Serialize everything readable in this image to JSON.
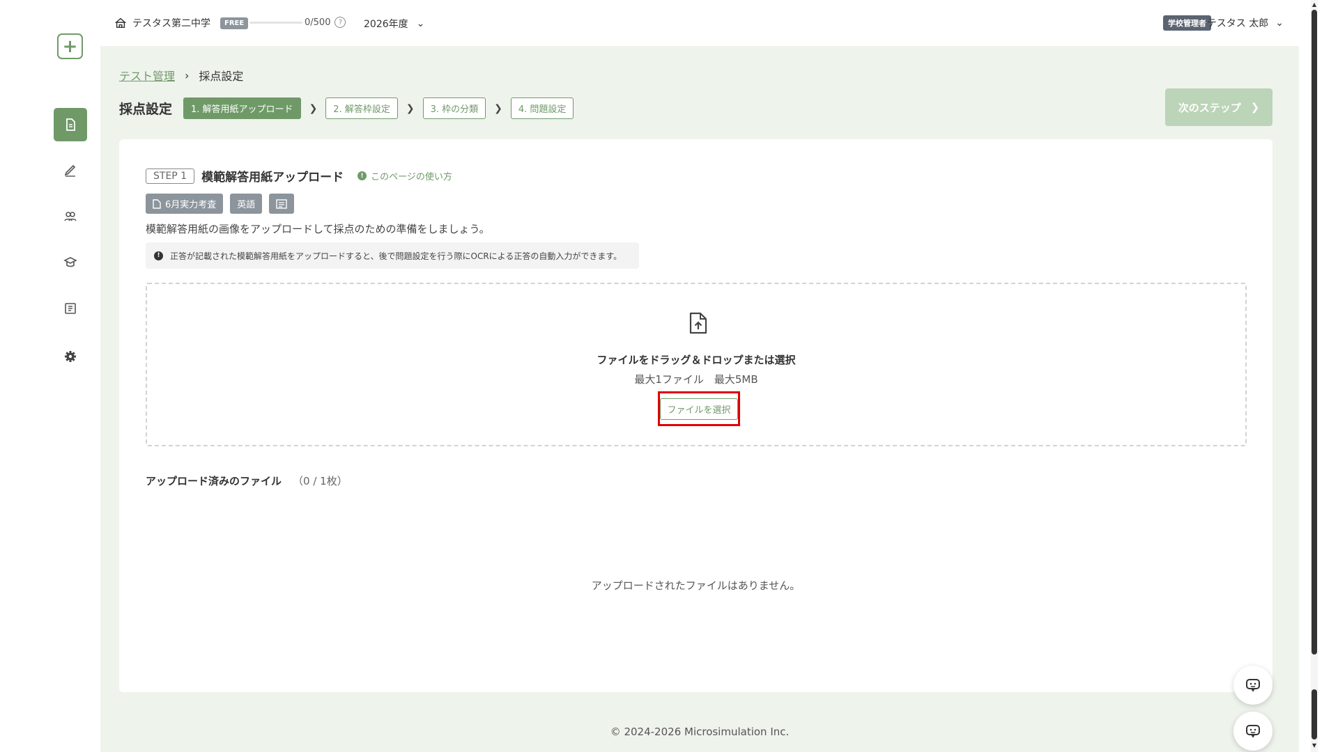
{
  "topbar": {
    "school_name": "テスタス第二中学",
    "plan_badge": "FREE",
    "usage_count": "0/500",
    "usage_fraction": 0,
    "help_glyph": "?",
    "year": "2026年度",
    "role_badge": "学校管理者",
    "user_name": "テスタス 太郎"
  },
  "sidebar": {
    "add_icon": "plus-icon",
    "items": [
      {
        "icon": "document-icon",
        "active": true
      },
      {
        "icon": "pen-icon",
        "active": false
      },
      {
        "icon": "users-icon",
        "active": false
      },
      {
        "icon": "graduation-cap-icon",
        "active": false
      },
      {
        "icon": "book-icon",
        "active": false
      },
      {
        "icon": "gear-icon",
        "active": false
      }
    ]
  },
  "breadcrumb": {
    "parent": "テスト管理",
    "current": "採点設定"
  },
  "header": {
    "title": "採点設定",
    "steps": [
      {
        "label": "1. 解答用紙アップロード",
        "active": true
      },
      {
        "label": "2. 解答枠設定",
        "active": false
      },
      {
        "label": "3. 枠の分類",
        "active": false
      },
      {
        "label": "4. 問題設定",
        "active": false
      }
    ],
    "next_button": "次のステップ"
  },
  "card": {
    "step_badge": "STEP 1",
    "step_title": "模範解答用紙アップロード",
    "howto_link": "このページの使い方",
    "tags": {
      "test_name": "6月実力考査",
      "subject": "英語"
    },
    "description": "模範解答用紙の画像をアップロードして採点のための準備をしましょう。",
    "info": "正答が記載された模範解答用紙をアップロードすると、後で問題設定を行う際にOCRによる正答の自動入力ができます。",
    "dropzone": {
      "title": "ファイルをドラッグ＆ドロップまたは選択",
      "limits": "最大1ファイル　最大5MB",
      "select_button": "ファイルを選択"
    },
    "uploaded": {
      "title": "アップロード済みのファイル",
      "count": "（0 / 1枚）",
      "empty_message": "アップロードされたファイルはありません。"
    }
  },
  "footer": {
    "copyright": "© 2024-2026 Microsimulation Inc."
  },
  "colors": {
    "accent": "#6f9a68",
    "highlight": "#e00000"
  }
}
